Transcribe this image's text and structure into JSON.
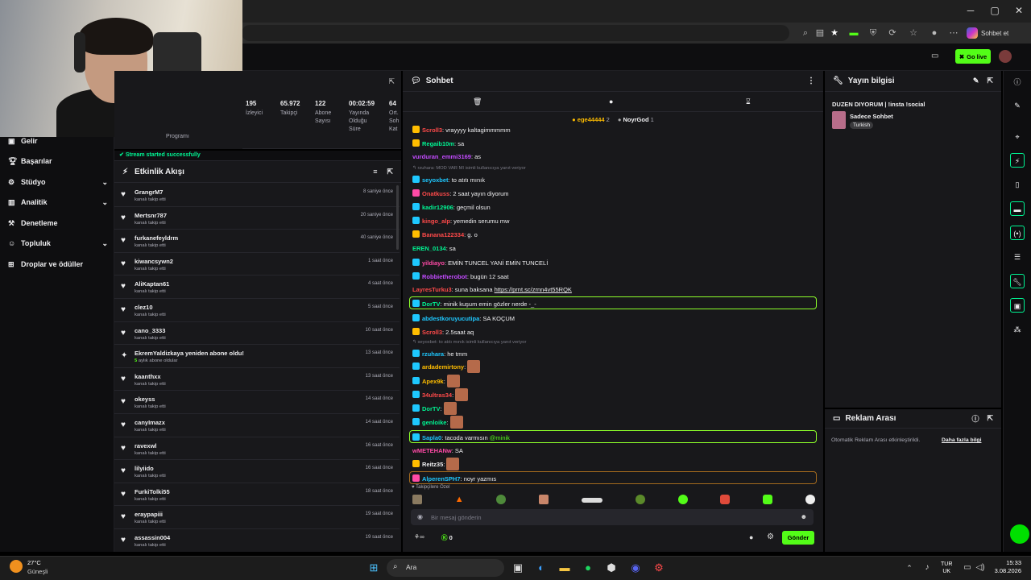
{
  "browser": {
    "profile_label": "Sohbet et"
  },
  "appbar": {
    "golive_label": "Go live"
  },
  "sidebar": {
    "items": [
      {
        "label": "Gelir",
        "icon": "dollar-icon"
      },
      {
        "label": "Başarılar",
        "icon": "trophy-icon"
      },
      {
        "label": "Stüdyo",
        "icon": "studio-icon"
      },
      {
        "label": "Analitik",
        "icon": "chart-icon"
      },
      {
        "label": "Denetleme",
        "icon": "moderation-icon"
      },
      {
        "label": "Topluluk",
        "icon": "community-icon"
      },
      {
        "label": "Droplar ve ödüller",
        "icon": "gift-icon"
      }
    ]
  },
  "stats": {
    "partial_label": "Programı",
    "items": [
      {
        "value": "195",
        "label": "İzleyici"
      },
      {
        "value": "65.972",
        "label": "Takipçi"
      },
      {
        "value": "122",
        "label": "Abone Sayısı"
      },
      {
        "value": "00:02:59",
        "label": "Yayında Olduğu Süre"
      },
      {
        "value": "64",
        "label": "Ort. Soh Kat"
      }
    ],
    "stream_status": "Stream started successfully"
  },
  "activity": {
    "title": "Etkinlik Akışı",
    "items": [
      {
        "name": "GrangrM7",
        "sub": "kanalı takip etti",
        "time": "8 saniye önce",
        "icon": "heart"
      },
      {
        "name": "Mertsnr787",
        "sub": "kanalı takip etti",
        "time": "20 saniye önce",
        "icon": "heart"
      },
      {
        "name": "furkanefeyldrm",
        "sub": "kanalı takip etti",
        "time": "40 saniye önce",
        "icon": "heart"
      },
      {
        "name": "kiwancsywn2",
        "sub": "kanalı takip etti",
        "time": "1 saat önce",
        "icon": "heart"
      },
      {
        "name": "AliKaptan61",
        "sub": "kanalı takip etti",
        "time": "4 saat önce",
        "icon": "heart"
      },
      {
        "name": "clez10",
        "sub": "kanalı takip etti",
        "time": "5 saat önce",
        "icon": "heart"
      },
      {
        "name": "cano_3333",
        "sub": "kanalı takip etti",
        "time": "10 saat önce",
        "icon": "heart"
      },
      {
        "name": "EkremYaldizkaya yeniden abone oldu!",
        "sub_count": "5",
        "sub": " aylık abone oldular",
        "time": "13 saat önce",
        "icon": "star"
      },
      {
        "name": "kaanthxx",
        "sub": "kanalı takip etti",
        "time": "13 saat önce",
        "icon": "heart"
      },
      {
        "name": "okeyss",
        "sub": "kanalı takip etti",
        "time": "14 saat önce",
        "icon": "heart"
      },
      {
        "name": "canyImazx",
        "sub": "kanalı takip etti",
        "time": "14 saat önce",
        "icon": "heart"
      },
      {
        "name": "ravexwl",
        "sub": "kanalı takip etti",
        "time": "16 saat önce",
        "icon": "heart"
      },
      {
        "name": "lilyiido",
        "sub": "kanalı takip etti",
        "time": "16 saat önce",
        "icon": "heart"
      },
      {
        "name": "FurkiTolki55",
        "sub": "kanalı takip etti",
        "time": "18 saat önce",
        "icon": "heart"
      },
      {
        "name": "eraypapiii",
        "sub": "kanalı takip etti",
        "time": "19 saat önce",
        "icon": "heart"
      },
      {
        "name": "assassin004",
        "sub": "kanalı takip etti",
        "time": "19 saat önce",
        "icon": "heart"
      }
    ]
  },
  "chat": {
    "title": "Sohbet",
    "pinned": [
      {
        "name": "ege44444",
        "count": "2"
      },
      {
        "name": "NoyrGod",
        "count": "1"
      }
    ],
    "messages": [
      {
        "user": "Scroll3",
        "color": "#ff4a4a",
        "text": ": vrayyyy kaltagimmmmm",
        "badge": "#ffbd00"
      },
      {
        "user": "Regaib10m",
        "color": "#00f593",
        "text": ": sa",
        "badge": "#ffbd00"
      },
      {
        "user": "vurduran_emmi3169",
        "color": "#c34bff",
        "text": ": as"
      },
      {
        "reply": "rzuhara: MOD VAR MI isimli kullanıcıya yanıt veriyor"
      },
      {
        "user": "seyoxbet",
        "color": "#1ec8ff",
        "text": ": to atıtı mınık",
        "badge": "#1ec8ff"
      },
      {
        "user": "Onatkuss",
        "color": "#ff4a4a",
        "text": ": 2 saat yayın diyorum",
        "badge": "#ff4aa6"
      },
      {
        "user": "kadir12906",
        "color": "#00f593",
        "text": ": geçmil olsun",
        "badge": "#1ec8ff"
      },
      {
        "user": "kingo_alp",
        "color": "#ff4a4a",
        "text": ": yemedin serumu mw",
        "badge": "#1ec8ff"
      },
      {
        "user": "Banana122334",
        "color": "#ff4a4a",
        "text": ": g. o",
        "badge": "#ffbd00"
      },
      {
        "user": "EREN_0134",
        "color": "#00f593",
        "text": ": sa"
      },
      {
        "user": "yildiayo",
        "color": "#ff4aa6",
        "text": ": EMİN TUNCEL YANİ EMİN TUNCELİ",
        "badge": "#1ec8ff"
      },
      {
        "user": "Robbietherobot",
        "color": "#c34bff",
        "text": ": bugün 12 saat",
        "badge": "#1ec8ff"
      },
      {
        "user": "LayresTurku3",
        "color": "#ff4a4a",
        "text": ": suna baksana ",
        "link": "https://prnt.sc/zrnn4vt55RQK"
      },
      {
        "user": "DorTV",
        "color": "#00f593",
        "text": ": minik kuşum emin gözler nerde -_-",
        "badge": "#1ec8ff",
        "highlight": true
      },
      {
        "user": "abdestkoruyucutipa",
        "color": "#1ec8ff",
        "text": ": SA KOÇUM",
        "badge": "#1ec8ff"
      },
      {
        "user": "Scroll3",
        "color": "#ff4a4a",
        "text": ": 2.5saat aq",
        "badge": "#ffbd00"
      },
      {
        "reply": "seyoxbet: to atıtı mınık isimli kullanıcıya yanıt veriyor"
      },
      {
        "user": "rzuhara",
        "color": "#1ec8ff",
        "text": ": he tmm",
        "badge": "#1ec8ff"
      },
      {
        "user": "ardademirtony",
        "color": "#ffbd00",
        "text": ":",
        "badge": "#1ec8ff",
        "emote": true
      },
      {
        "user": "Apex9k",
        "color": "#ffbd00",
        "text": ":",
        "badge": "#1ec8ff",
        "emote": true
      },
      {
        "user": "34ultras34",
        "color": "#ff4a4a",
        "text": ":",
        "badge": "#1ec8ff",
        "emote": true
      },
      {
        "user": "DorTV",
        "color": "#00f593",
        "text": ":",
        "badge": "#1ec8ff",
        "emote": true
      },
      {
        "user": "genloike",
        "color": "#00f593",
        "text": ":",
        "badge": "#1ec8ff",
        "emote": true
      },
      {
        "user": "Sapla0",
        "color": "#1ec8ff",
        "text": ": tacoda varmısın ",
        "mention": "@minik",
        "badge": "#1ec8ff",
        "highlight": true
      },
      {
        "user": "wMETEHANw",
        "color": "#ff4aa6",
        "text": ": SA"
      },
      {
        "user": "Reitz35",
        "color": "#efeff1",
        "text": ":",
        "badge": "#ffbd00",
        "emote": true
      },
      {
        "user": "AlperenSPH7",
        "color": "#1ec8ff",
        "text": ": noyr yazmıs",
        "badge": "#ff4aa6",
        "highlight": "orange"
      }
    ],
    "emote_bar_label": "Takipçilere Özel",
    "input_placeholder": "Bir mesaj gönderin",
    "points": "0",
    "send_label": "Gönder"
  },
  "info": {
    "title": "Yayın bilgisi",
    "stream_title": "DUZEN DIYORUM | !insta !social",
    "category": "Sadece Sohbet",
    "tag": "Turkish"
  },
  "ads": {
    "title": "Reklam Arası",
    "text": "Otomatik Reklam Arası etkinleştirildi.",
    "link": "Daha fazla bilgi"
  },
  "taskbar": {
    "weather_temp": "27°C",
    "weather_desc": "Güneşli",
    "search_label": "Ara",
    "lang_line1": "TUR",
    "lang_line2": "UK",
    "time": "15:33",
    "date": "3.08.2026"
  },
  "colors": {
    "accent": "#53fc18",
    "panel_bg": "#18181b"
  }
}
